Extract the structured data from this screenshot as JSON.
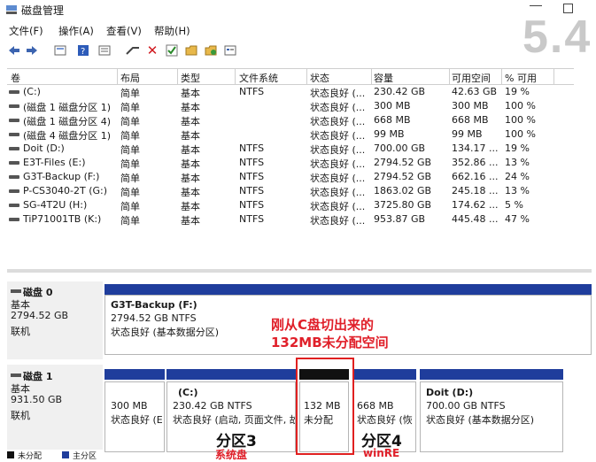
{
  "window": {
    "title": "磁盘管理",
    "watermark": "5.4"
  },
  "menu": {
    "items": [
      "文件(F)",
      "操作(A)",
      "查看(V)",
      "帮助(H)"
    ]
  },
  "toolbar": {
    "icons": [
      "back-icon",
      "forward-icon",
      "console-icon",
      "help-icon",
      "list-icon",
      "connect-icon",
      "delete-icon",
      "check-icon",
      "folder-icon",
      "folder-open-icon",
      "properties-icon"
    ]
  },
  "volumes": {
    "headers": [
      "卷",
      "布局",
      "类型",
      "文件系统",
      "状态",
      "容量",
      "可用空间",
      "% 可用"
    ],
    "rows": [
      [
        "(C:)",
        "简单",
        "基本",
        "NTFS",
        "状态良好 (...",
        "230.42 GB",
        "42.63 GB",
        "19 %"
      ],
      [
        "(磁盘 1 磁盘分区 1)",
        "简单",
        "基本",
        "",
        "状态良好 (...",
        "300 MB",
        "300 MB",
        "100 %"
      ],
      [
        "(磁盘 1 磁盘分区 4)",
        "简单",
        "基本",
        "",
        "状态良好 (...",
        "668 MB",
        "668 MB",
        "100 %"
      ],
      [
        "(磁盘 4 磁盘分区 1)",
        "简单",
        "基本",
        "",
        "状态良好 (...",
        "99 MB",
        "99 MB",
        "100 %"
      ],
      [
        "Doit (D:)",
        "简单",
        "基本",
        "NTFS",
        "状态良好 (...",
        "700.00 GB",
        "134.17 ...",
        "19 %"
      ],
      [
        "E3T-Files (E:)",
        "简单",
        "基本",
        "NTFS",
        "状态良好 (...",
        "2794.52 GB",
        "352.86 ...",
        "13 %"
      ],
      [
        "G3T-Backup (F:)",
        "简单",
        "基本",
        "NTFS",
        "状态良好 (...",
        "2794.52 GB",
        "662.16 ...",
        "24 %"
      ],
      [
        "P-CS3040-2T (G:)",
        "简单",
        "基本",
        "NTFS",
        "状态良好 (...",
        "1863.02 GB",
        "245.18 ...",
        "13 %"
      ],
      [
        "SG-4T2U (H:)",
        "简单",
        "基本",
        "NTFS",
        "状态良好 (...",
        "3725.80 GB",
        "174.62 ...",
        "5 %"
      ],
      [
        "TiP71001TB (K:)",
        "简单",
        "基本",
        "NTFS",
        "状态良好 (...",
        "953.87 GB",
        "445.48 ...",
        "47 %"
      ]
    ]
  },
  "disk0": {
    "name": "磁盘 0",
    "type": "基本",
    "size": "2794.52 GB",
    "status": "联机",
    "partition": {
      "name": "G3T-Backup  (F:)",
      "size": "2794.52 GB NTFS",
      "status": "状态良好 (基本数据分区)"
    }
  },
  "disk1": {
    "name": "磁盘 1",
    "type": "基本",
    "size": "931.50 GB",
    "status": "联机",
    "partitions": [
      {
        "name": "",
        "size": "300 MB",
        "status": "状态良好 (E"
      },
      {
        "name": "(C:)",
        "size": "230.42 GB NTFS",
        "status": "状态良好 (启动, 页面文件, 故"
      },
      {
        "name": "",
        "size": "132 MB",
        "status": "未分配"
      },
      {
        "name": "",
        "size": "668 MB",
        "status": "状态良好 (恢"
      },
      {
        "name": "Doit  (D:)",
        "size": "700.00 GB NTFS",
        "status": "状态良好 (基本数据分区)"
      }
    ]
  },
  "annotations": {
    "note_line1": "刚从C盘切出来的",
    "note_line2": "132MB未分配空间",
    "label3": "分区3",
    "label3_sub": "系统盘",
    "label4": "分区4",
    "label4_sub": "winRE"
  },
  "legend": {
    "items": [
      "未分配",
      "主分区"
    ]
  },
  "colors": {
    "primary_bar": "#1f3d9c",
    "unallocated_bar": "#111111",
    "annotation_red": "#e0202a"
  }
}
